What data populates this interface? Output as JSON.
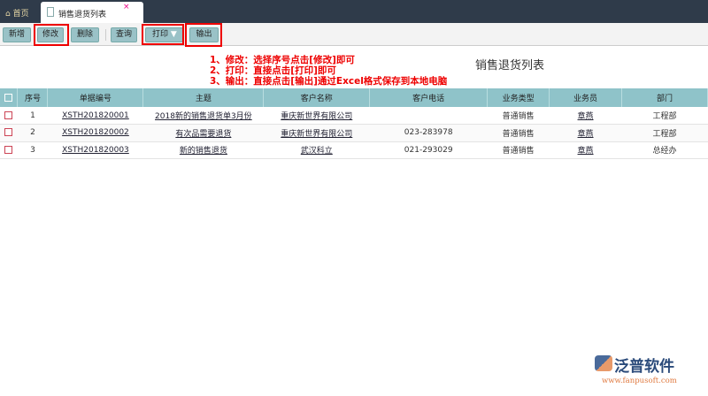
{
  "tabs": {
    "home": "首页",
    "active": "销售退货列表",
    "close": "×"
  },
  "toolbar": {
    "add": "新增",
    "edit": "修改",
    "delete": "删除",
    "query": "查询",
    "print": "打印",
    "export": "输出"
  },
  "notes": [
    "1、修改：选择序号点击[修改]即可",
    "2、打印：直接点击[打印]即可",
    "3、输出：直接点击[输出]通过Excel格式保存到本地电脑"
  ],
  "page_title": "销售退货列表",
  "columns": [
    "序号",
    "单据编号",
    "主题",
    "客户名称",
    "客户电话",
    "业务类型",
    "业务员",
    "部门"
  ],
  "rows": [
    {
      "no": "1",
      "code": "XSTH201820001",
      "subject": "2018新的销售退货单3月份",
      "customer": "重庆新世界有限公司",
      "phone": "",
      "type": "普通销售",
      "staff": "章燕",
      "dept": "工程部"
    },
    {
      "no": "2",
      "code": "XSTH201820002",
      "subject": "有次品需要退货",
      "customer": "重庆新世界有限公司",
      "phone": "023-283978",
      "type": "普通销售",
      "staff": "章燕",
      "dept": "工程部"
    },
    {
      "no": "3",
      "code": "XSTH201820003",
      "subject": "新的销售退货",
      "customer": "武汉科立",
      "phone": "021-293029",
      "type": "普通销售",
      "staff": "章燕",
      "dept": "总经办"
    }
  ],
  "logo": {
    "name": "泛普软件",
    "url": "www.fanpusoft.com"
  }
}
